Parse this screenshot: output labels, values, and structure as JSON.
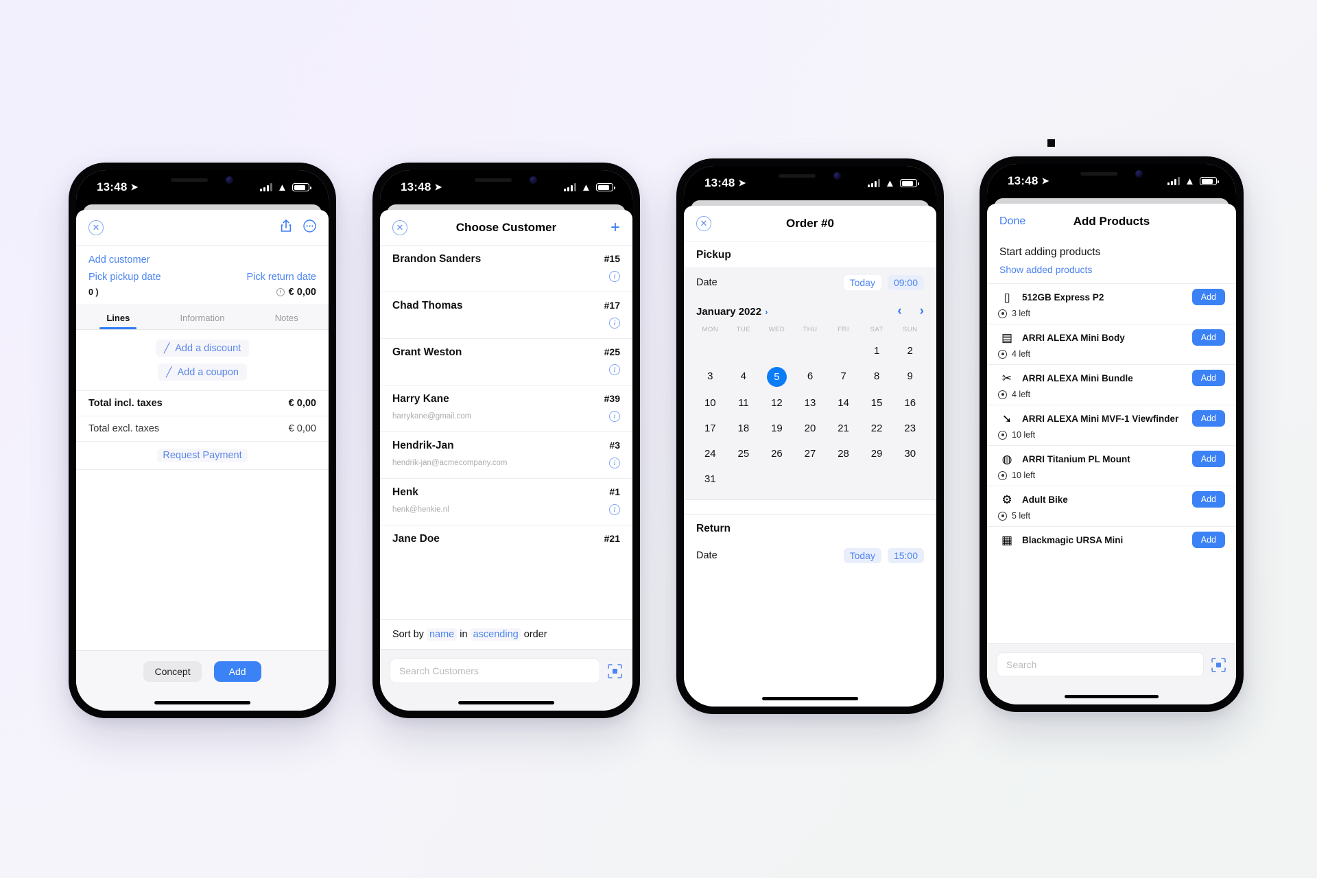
{
  "status_bar": {
    "time": "13:48",
    "location_icon": "navigation-arrow-icon"
  },
  "phone1": {
    "header": {
      "close_icon": "close-circle-icon",
      "share_icon": "share-icon",
      "more_icon": "more-circle-icon"
    },
    "add_customer": "Add customer",
    "pick_pickup_date": "Pick pickup date",
    "pick_return_date": "Pick return date",
    "item_count": "0 )",
    "total_badge": "€ 0,00",
    "tabs": [
      {
        "label": "Lines",
        "active": true
      },
      {
        "label": "Information",
        "active": false
      },
      {
        "label": "Notes",
        "active": false
      }
    ],
    "add_discount": "Add a discount",
    "add_coupon": "Add a coupon",
    "totals": [
      {
        "label": "Total incl. taxes",
        "value": "€ 0,00",
        "bold": true
      },
      {
        "label": "Total excl. taxes",
        "value": "€ 0,00",
        "bold": false
      }
    ],
    "request_payment": "Request Payment",
    "footer": {
      "concept": "Concept",
      "add": "Add"
    }
  },
  "phone2": {
    "title": "Choose Customer",
    "add_icon": "plus-icon",
    "customers": [
      {
        "name": "Brandon Sanders",
        "id": "#15",
        "email": ""
      },
      {
        "name": "Chad Thomas",
        "id": "#17",
        "email": ""
      },
      {
        "name": "Grant Weston",
        "id": "#25",
        "email": ""
      },
      {
        "name": "Harry Kane",
        "id": "#39",
        "email": "harrykane@gmail.com"
      },
      {
        "name": "Hendrik-Jan",
        "id": "#3",
        "email": "hendrik-jan@acmecompany.com"
      },
      {
        "name": "Henk",
        "id": "#1",
        "email": "henk@henkie.nl"
      },
      {
        "name": "Jane Doe",
        "id": "#21",
        "email": ""
      }
    ],
    "sort": {
      "prefix": "Sort by",
      "field": "name",
      "mid": "in",
      "direction": "ascending",
      "suffix": "order"
    },
    "search_placeholder": "Search Customers",
    "scan_icon": "scan-barcode-icon"
  },
  "phone3": {
    "title": "Order #0",
    "pickup": {
      "section": "Pickup",
      "date_label": "Date",
      "day_value": "Today",
      "time_value": "09:00"
    },
    "calendar": {
      "month": "January 2022",
      "prev_icon": "chevron-left-icon",
      "next_icon": "chevron-right-icon",
      "weekdays": [
        "MON",
        "TUE",
        "WED",
        "THU",
        "FRI",
        "SAT",
        "SUN"
      ],
      "leading_blanks": 5,
      "days": [
        1,
        2,
        3,
        4,
        5,
        6,
        7,
        8,
        9,
        10,
        11,
        12,
        13,
        14,
        15,
        16,
        17,
        18,
        19,
        20,
        21,
        22,
        23,
        24,
        25,
        26,
        27,
        28,
        29,
        30,
        31
      ],
      "selected_day": 5
    },
    "return": {
      "section": "Return",
      "date_label": "Date",
      "day_value": "Today",
      "time_value": "15:00"
    }
  },
  "phone4": {
    "done": "Done",
    "title": "Add Products",
    "intro": "Start adding products",
    "show_added": "Show added products",
    "add_label": "Add",
    "products": [
      {
        "name": "512GB Express P2",
        "stock": "3 left",
        "icon": "memory-card-icon",
        "glyph": "▯"
      },
      {
        "name": "ARRI ALEXA Mini Body",
        "stock": "4 left",
        "icon": "camera-body-icon",
        "glyph": "▤"
      },
      {
        "name": "ARRI ALEXA Mini Bundle",
        "stock": "4 left",
        "icon": "camera-rig-icon",
        "glyph": "✂"
      },
      {
        "name": "ARRI ALEXA Mini MVF-1 Viewfinder",
        "stock": "10 left",
        "icon": "viewfinder-icon",
        "glyph": "➘"
      },
      {
        "name": "ARRI Titanium PL Mount",
        "stock": "10 left",
        "icon": "lens-mount-icon",
        "glyph": "◍"
      },
      {
        "name": "Adult Bike",
        "stock": "5 left",
        "icon": "bicycle-icon",
        "glyph": "⚙"
      },
      {
        "name": "Blackmagic URSA Mini",
        "stock": "",
        "icon": "cinema-camera-icon",
        "glyph": "▦"
      }
    ],
    "search_placeholder": "Search",
    "scan_icon": "scan-barcode-icon"
  }
}
